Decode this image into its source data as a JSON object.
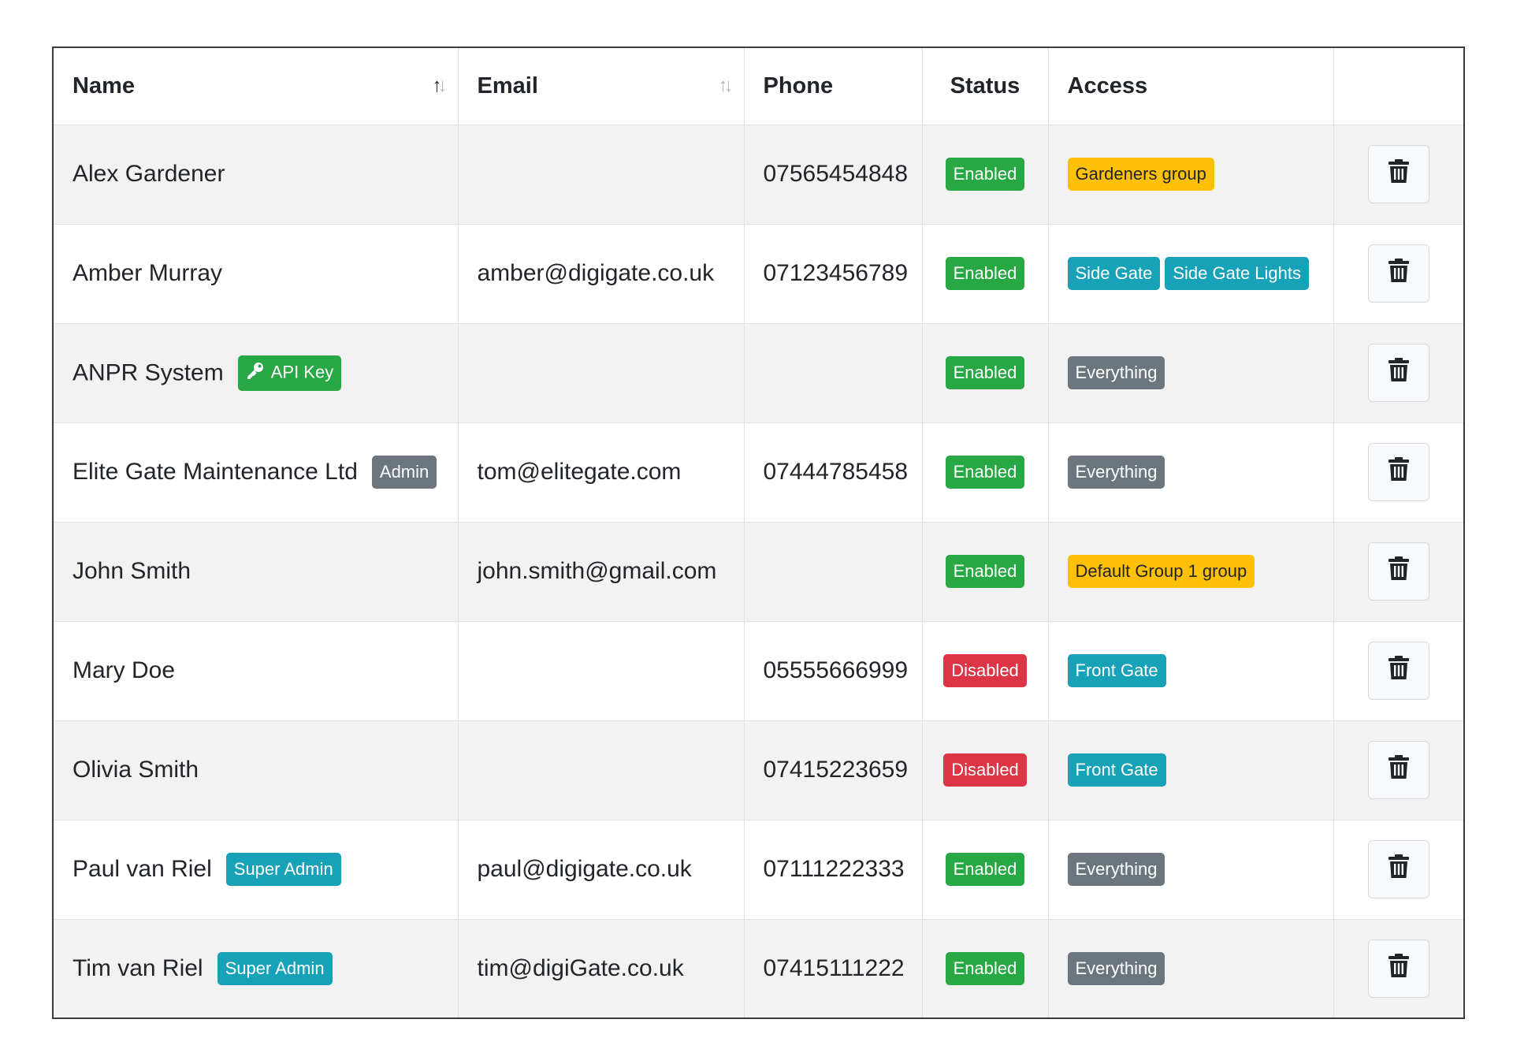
{
  "table": {
    "headers": {
      "name": "Name",
      "email": "Email",
      "phone": "Phone",
      "status": "Status",
      "access": "Access"
    },
    "sort_icons": {
      "name": "sort-ascending-icon",
      "email": "sort-icon"
    },
    "rows": [
      {
        "name": "Alex Gardener",
        "email": "",
        "phone": "07565454848",
        "status": "Enabled",
        "access": [
          "Gardeners group"
        ]
      },
      {
        "name": "Amber Murray",
        "email": "amber@digigate.co.uk",
        "phone": "07123456789",
        "status": "Enabled",
        "access": [
          "Side Gate",
          "Side Gate Lights"
        ]
      },
      {
        "name": "ANPR System",
        "name_badge": "API Key",
        "name_badge_icon": "key-icon",
        "email": "",
        "phone": "",
        "status": "Enabled",
        "access": [
          "Everything"
        ]
      },
      {
        "name": "Elite Gate Maintenance Ltd",
        "name_badge": "Admin",
        "email": "tom@elitegate.com",
        "phone": "07444785458",
        "status": "Enabled",
        "access": [
          "Everything"
        ]
      },
      {
        "name": "John Smith",
        "email": "john.smith@gmail.com",
        "phone": "",
        "status": "Enabled",
        "access": [
          "Default Group 1 group"
        ]
      },
      {
        "name": "Mary Doe",
        "email": "",
        "phone": "05555666999",
        "status": "Disabled",
        "access": [
          "Front Gate"
        ]
      },
      {
        "name": "Olivia Smith",
        "email": "",
        "phone": "07415223659",
        "status": "Disabled",
        "access": [
          "Front Gate"
        ]
      },
      {
        "name": "Paul van Riel",
        "name_badge": "Super Admin",
        "email": "paul@digigate.co.uk",
        "phone": "07111222333",
        "status": "Enabled",
        "access": [
          "Everything"
        ]
      },
      {
        "name": "Tim van Riel",
        "name_badge": "Super Admin",
        "email": "tim@digiGate.co.uk",
        "phone": "07415111222",
        "status": "Enabled",
        "access": [
          "Everything"
        ]
      }
    ],
    "row_action_icon": "trash-icon"
  },
  "colors": {
    "enabled": "#28a745",
    "disabled": "#dc3545",
    "everything": "#6c757d",
    "gate": "#17a2b8",
    "group": "#ffc107",
    "api_key": "#28a745",
    "admin": "#6c757d",
    "super_admin": "#17a2b8"
  }
}
